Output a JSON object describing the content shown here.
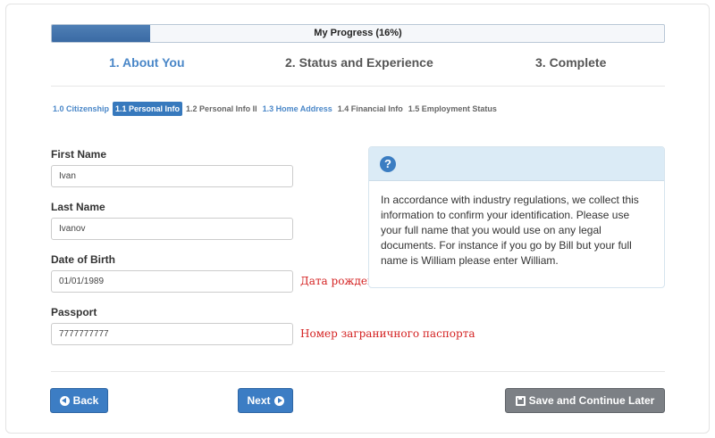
{
  "progress": {
    "label": "My Progress (16%)",
    "percent": 16
  },
  "steps": [
    {
      "label": "1. About You",
      "active": true
    },
    {
      "label": "2. Status and Experience",
      "active": false
    },
    {
      "label": "3. Complete",
      "active": false
    }
  ],
  "subnav": [
    {
      "label": "1.0 Citizenship",
      "state": "link"
    },
    {
      "label": "1.1 Personal Info",
      "state": "current"
    },
    {
      "label": "1.2 Personal Info II",
      "state": "plain"
    },
    {
      "label": "1.3 Home Address",
      "state": "link"
    },
    {
      "label": "1.4 Financial Info",
      "state": "plain"
    },
    {
      "label": "1.5 Employment Status",
      "state": "plain"
    }
  ],
  "form": {
    "first_name": {
      "label": "First Name",
      "value": "Ivan"
    },
    "last_name": {
      "label": "Last Name",
      "value": "Ivanov"
    },
    "dob": {
      "label": "Date of Birth",
      "value": "01/01/1989",
      "annotation": "Дата рождения"
    },
    "passport": {
      "label": "Passport",
      "value": "7777777777",
      "annotation": "Номер заграничного паспорта"
    }
  },
  "info_panel": {
    "icon": "question-circle-icon",
    "text": "In accordance with industry regulations, we collect this information to confirm your identification. Please use your full name that you would use on any legal documents. For instance if you go by Bill but your full name is William please enter William."
  },
  "buttons": {
    "back": "Back",
    "next": "Next",
    "save": "Save and Continue Later"
  },
  "colors": {
    "primary": "#3c7dc4",
    "step_active": "#4a87c8",
    "annotation": "#d42222",
    "panel_header": "#dbebf6"
  }
}
